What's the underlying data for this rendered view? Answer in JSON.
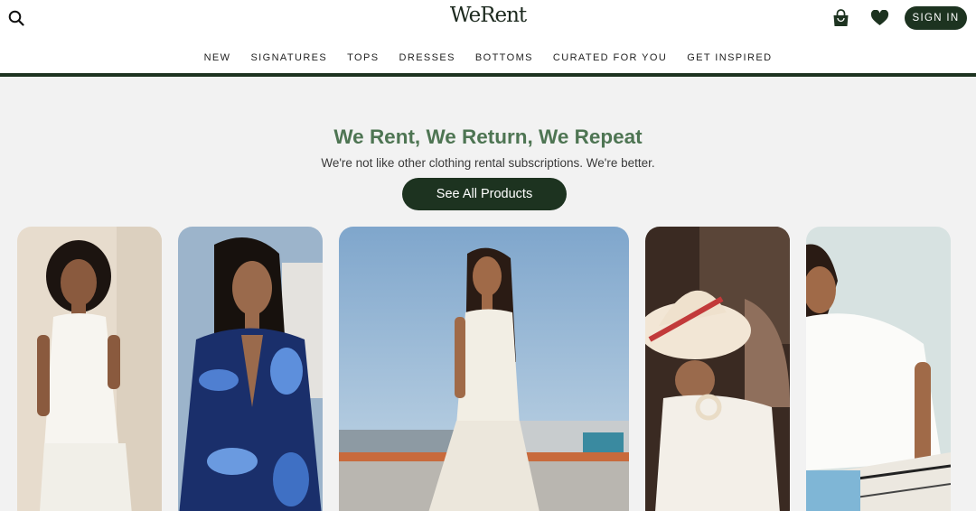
{
  "header": {
    "logo": "WeRent",
    "signin_label": "SIGN IN",
    "icons": [
      "search-icon",
      "shopping-bag-icon",
      "heart-icon"
    ]
  },
  "nav": {
    "items": [
      "NEW",
      "SIGNATURES",
      "TOPS",
      "DRESSES",
      "BOTTOMS",
      "CURATED FOR YOU",
      "GET INSPIRED"
    ]
  },
  "hero": {
    "title": "We Rent, We Return, We Repeat",
    "subtitle": "We're not like other clothing rental subscriptions. We're better.",
    "cta_label": "See All Products"
  },
  "products": [
    {
      "image": "model-white-sleeveless-top"
    },
    {
      "image": "model-blue-floral-dress"
    },
    {
      "image": "model-white-lace-dress-rooftop"
    },
    {
      "image": "model-sun-hat-knit-top"
    },
    {
      "image": "model-white-blouse"
    }
  ],
  "colors": {
    "brand_dark_green": "#1d3320",
    "title_green": "#4e7553",
    "page_background": "#f2f2f2"
  }
}
